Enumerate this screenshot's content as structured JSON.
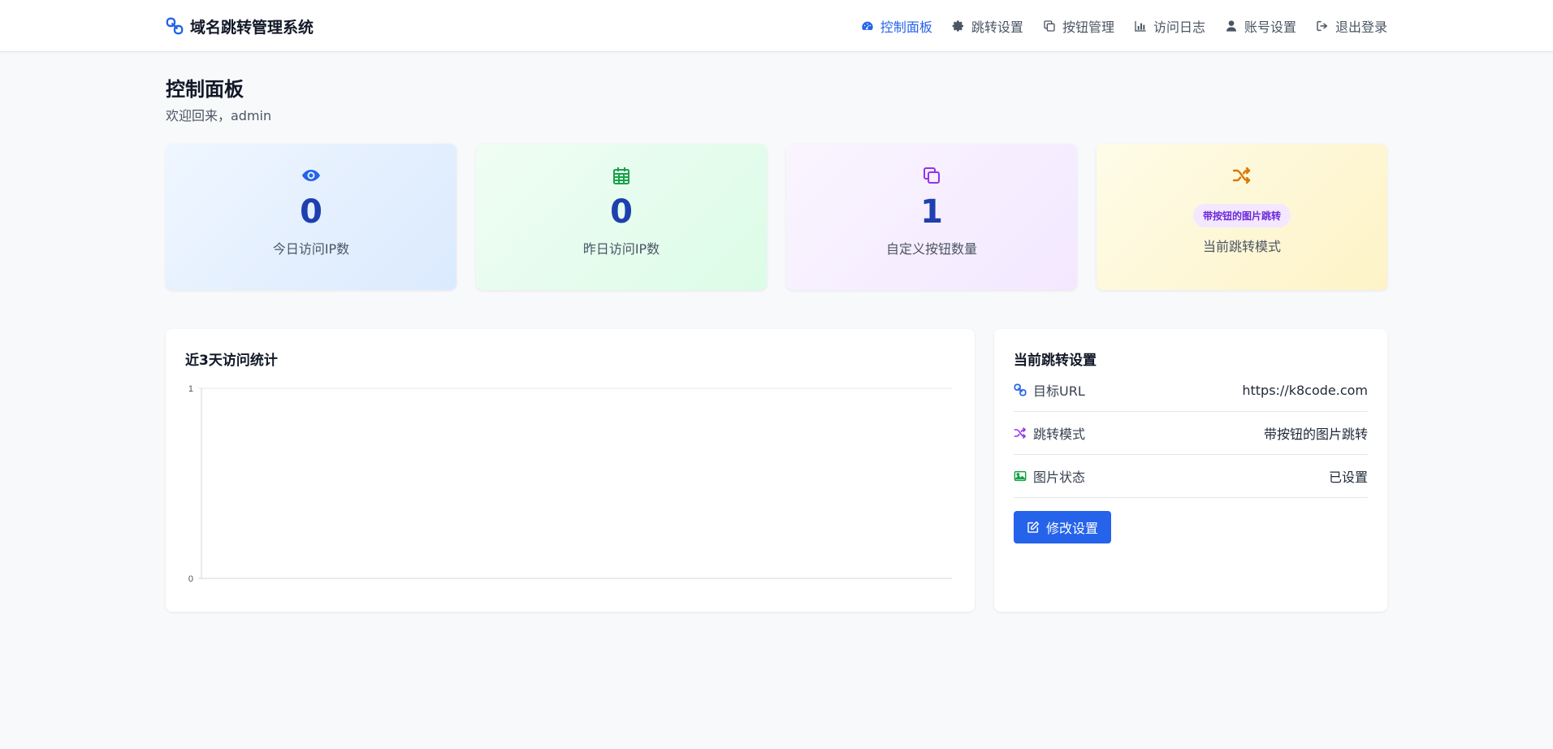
{
  "header": {
    "brand": "域名跳转管理系统",
    "nav": [
      {
        "label": "控制面板",
        "icon": "dashboard-icon",
        "active": true
      },
      {
        "label": "跳转设置",
        "icon": "gear-icon"
      },
      {
        "label": "按钮管理",
        "icon": "copy-icon"
      },
      {
        "label": "访问日志",
        "icon": "bar-chart-icon"
      },
      {
        "label": "账号设置",
        "icon": "user-icon"
      },
      {
        "label": "退出登录",
        "icon": "sign-out-icon"
      }
    ]
  },
  "page": {
    "title": "控制面板",
    "subtitle": "欢迎回来，admin"
  },
  "stats": [
    {
      "icon": "eye-icon",
      "value": "0",
      "label": "今日访问IP数",
      "color": "#2563eb"
    },
    {
      "icon": "calendar-icon",
      "value": "0",
      "label": "昨日访问IP数",
      "color": "#16a34a"
    },
    {
      "icon": "copy-icon",
      "value": "1",
      "label": "自定义按钮数量",
      "color": "#9333ea"
    },
    {
      "icon": "shuffle-icon",
      "pill": "带按钮的图片跳转",
      "label": "当前跳转模式",
      "color": "#d97706"
    }
  ],
  "chart_panel": {
    "title": "近3天访问统计"
  },
  "chart_data": {
    "type": "line",
    "title": "",
    "xlabel": "",
    "ylabel": "",
    "x": [],
    "series": [],
    "ylim": [
      0,
      1
    ],
    "yticks": [
      "0",
      "1"
    ],
    "grid": true
  },
  "settings_panel": {
    "title": "当前跳转设置",
    "rows": [
      {
        "icon": "link-icon",
        "label": "目标URL",
        "value": "https://k8code.com",
        "icon_color": "#2563eb"
      },
      {
        "icon": "shuffle-icon",
        "label": "跳转模式",
        "value": "带按钮的图片跳转",
        "icon_color": "#9333ea"
      },
      {
        "icon": "image-icon",
        "label": "图片状态",
        "value": "已设置",
        "icon_color": "#16a34a"
      }
    ],
    "edit_button": "修改设置"
  },
  "colors": {
    "accent": "#2563eb",
    "stat_value": "#1e40af"
  }
}
